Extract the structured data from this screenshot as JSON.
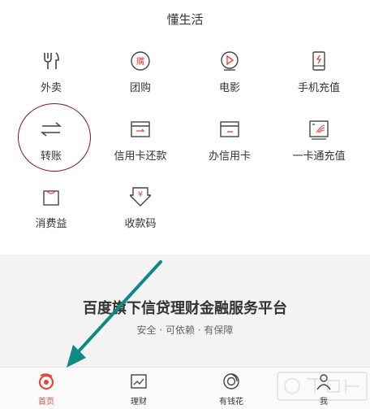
{
  "section_title": "懂生活",
  "grid": [
    {
      "label": "外卖",
      "icon": "fork-knife-icon"
    },
    {
      "label": "团购",
      "icon": "group-buy-icon"
    },
    {
      "label": "电影",
      "icon": "movie-play-icon"
    },
    {
      "label": "手机充值",
      "icon": "phone-charge-icon"
    },
    {
      "label": "转账",
      "icon": "transfer-arrows-icon"
    },
    {
      "label": "信用卡还款",
      "icon": "card-repay-icon"
    },
    {
      "label": "办信用卡",
      "icon": "card-apply-icon"
    },
    {
      "label": "一卡通充值",
      "icon": "transit-card-icon"
    },
    {
      "label": "消费益",
      "icon": "shopping-bag-icon"
    },
    {
      "label": "收款码",
      "icon": "receive-code-icon"
    }
  ],
  "group_buy_glyph": "購",
  "receive_glyph": "¥",
  "banner": {
    "title": "百度旗下信贷理财金融服务平台",
    "subtitle": "安全 · 可依赖 · 有保障"
  },
  "tabs": [
    {
      "label": "首页",
      "icon": "home-icon",
      "active": true
    },
    {
      "label": "理财",
      "icon": "chart-icon",
      "active": false
    },
    {
      "label": "有钱花",
      "icon": "wallet-ring-icon",
      "active": false
    },
    {
      "label": "我",
      "icon": "user-icon",
      "active": false
    }
  ],
  "colors": {
    "accent": "#e04a3a",
    "annotation_arrow": "#0e8a86",
    "annotation_circle": "#7a1a1a"
  }
}
